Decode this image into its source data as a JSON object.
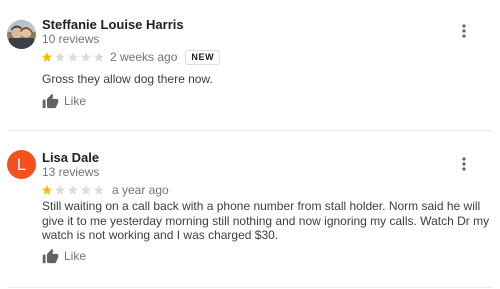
{
  "reviews": [
    {
      "reviewer_name": "Steffanie Louise Harris",
      "review_count": "10 reviews",
      "rating": 1,
      "max_rating": 5,
      "time_ago": "2 weeks ago",
      "badge": "NEW",
      "text": "Gross they allow dog there now.",
      "like_label": "Like",
      "avatar": "photo"
    },
    {
      "reviewer_name": "Lisa Dale",
      "review_count": "13 reviews",
      "rating": 1,
      "max_rating": 5,
      "time_ago": "a year ago",
      "text": "Still waiting on a call back with a phone number from stall holder. Norm said he will give it to me yesterday morning still nothing and now ignoring my calls. Watch Dr my watch is not working and I was charged $30.",
      "like_label": "Like",
      "avatar_letter": "L",
      "avatar_color": "#f4511e"
    }
  ],
  "colors": {
    "star_filled": "#fbbc04",
    "star_empty": "#dadce0",
    "secondary_text": "#70757a",
    "divider": "#e8eaed"
  },
  "icons": {
    "more": "more-vert-icon",
    "like": "thumb-up-icon",
    "star": "star-icon"
  }
}
